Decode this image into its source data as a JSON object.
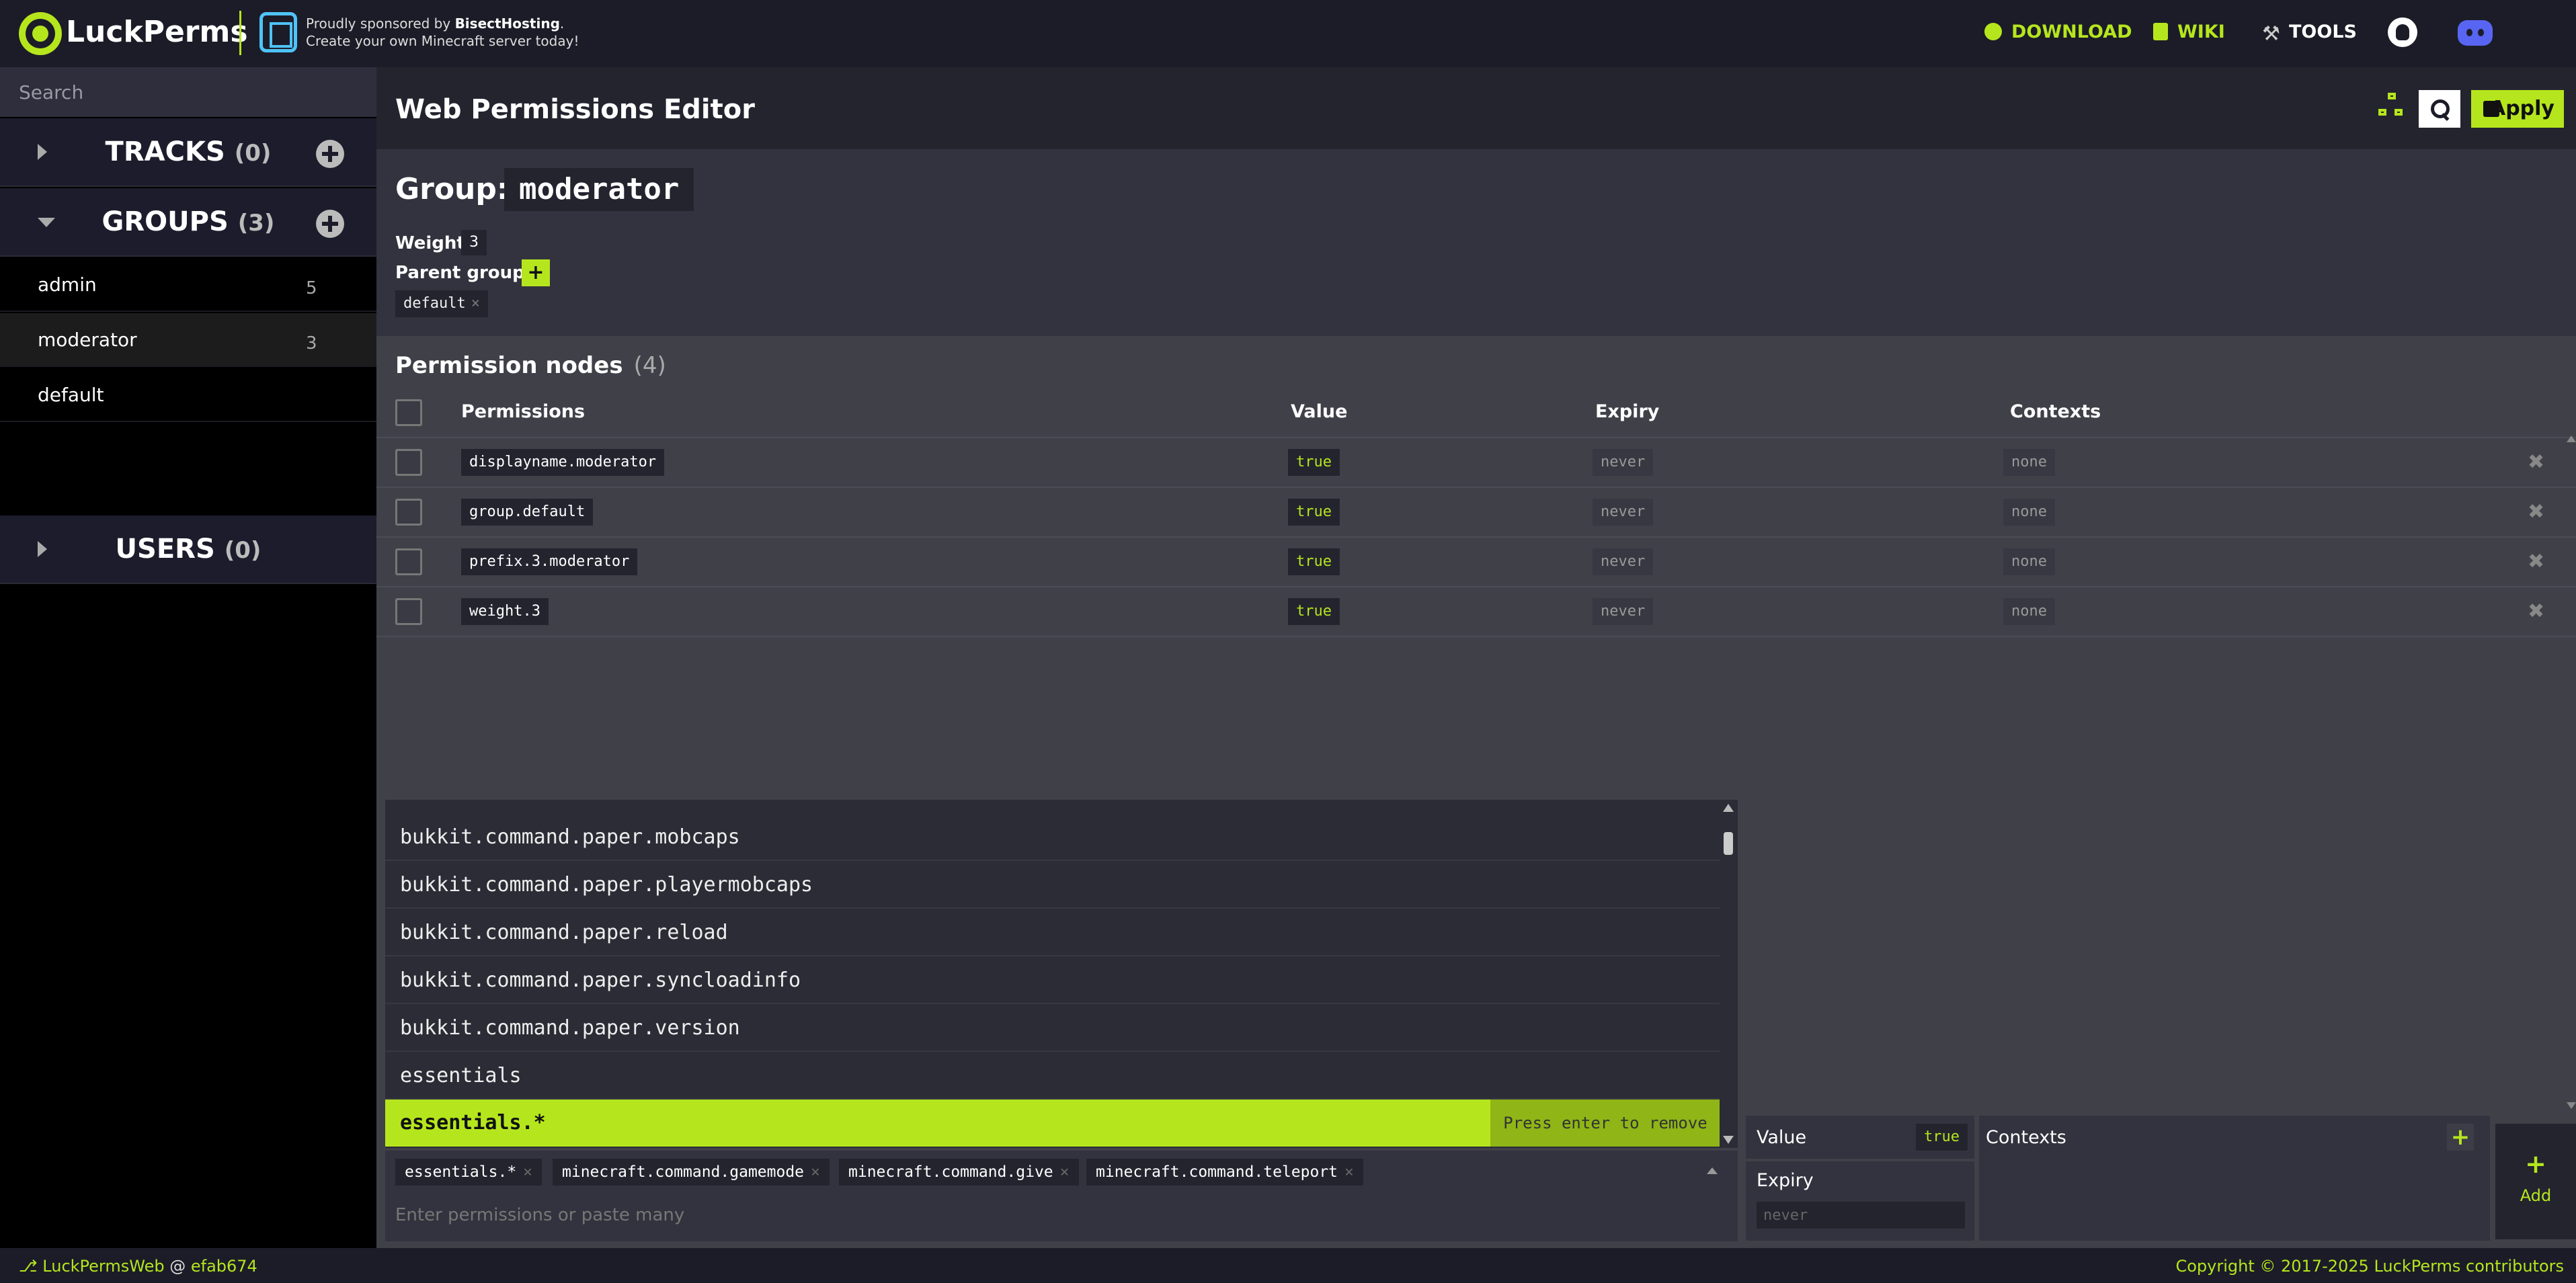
{
  "nav": {
    "brand": "LuckPerms",
    "sponsor_prefix": "Proudly sponsored by ",
    "sponsor_name": "BisectHosting",
    "sponsor_suffix": ".",
    "sponsor_line2": "Create your own Minecraft server today!",
    "links": {
      "download": "DOWNLOAD",
      "wiki": "WIKI",
      "tools": "TOOLS"
    },
    "accent": "#b5e61d"
  },
  "sidebar": {
    "search_placeholder": "Search",
    "tracks": {
      "label": "TRACKS",
      "count": "(0)"
    },
    "groups": {
      "label": "GROUPS",
      "count": "(3)",
      "items": [
        {
          "name": "admin",
          "weight": "5"
        },
        {
          "name": "moderator",
          "weight": "3"
        },
        {
          "name": "default",
          "weight": ""
        }
      ]
    },
    "users": {
      "label": "USERS",
      "count": "(0)"
    }
  },
  "header": {
    "title": "Web Permissions Editor",
    "apply_label": "Apply"
  },
  "group": {
    "label": "Group:",
    "name": "moderator",
    "weight_label": "Weight:",
    "weight": "3",
    "parent_label": "Parent groups",
    "parent_add": "+",
    "parents": [
      {
        "name": "default",
        "remove": "×"
      }
    ]
  },
  "permissions": {
    "title": "Permission nodes",
    "count": "(4)",
    "columns": {
      "permissions": "Permissions",
      "value": "Value",
      "expiry": "Expiry",
      "contexts": "Contexts"
    },
    "rows": [
      {
        "node": "displayname.moderator",
        "value": "true",
        "expiry": "never",
        "contexts": "none"
      },
      {
        "node": "group.default",
        "value": "true",
        "expiry": "never",
        "contexts": "none"
      },
      {
        "node": "prefix.3.moderator",
        "value": "true",
        "expiry": "never",
        "contexts": "none"
      },
      {
        "node": "weight.3",
        "value": "true",
        "expiry": "never",
        "contexts": "none"
      }
    ],
    "delete_glyph": "✖"
  },
  "dropdown": {
    "items": [
      "bukkit.command.paper.mobcaps",
      "bukkit.command.paper.playermobcaps",
      "bukkit.command.paper.reload",
      "bukkit.command.paper.syncloadinfo",
      "bukkit.command.paper.version",
      "essentials"
    ],
    "selected": "essentials.*",
    "selected_hint": "Press enter to remove"
  },
  "editor": {
    "tags": [
      {
        "label": "essentials.*",
        "x": "×"
      },
      {
        "label": "minecraft.command.gamemode",
        "x": "×"
      },
      {
        "label": "minecraft.command.give",
        "x": "×"
      },
      {
        "label": "minecraft.command.teleport",
        "x": "×"
      }
    ],
    "input_placeholder": "Enter permissions or paste many",
    "value_label": "Value",
    "value": "true",
    "expiry_label": "Expiry",
    "expiry_placeholder": "never",
    "contexts_label": "Contexts",
    "contexts_add": "+",
    "add_plus": "+",
    "add_label": "Add"
  },
  "footer": {
    "app": "LuckPermsWeb",
    "at": " @ ",
    "commit": "efab674",
    "copyright": "Copyright © 2017-2025 LuckPerms contributors"
  }
}
